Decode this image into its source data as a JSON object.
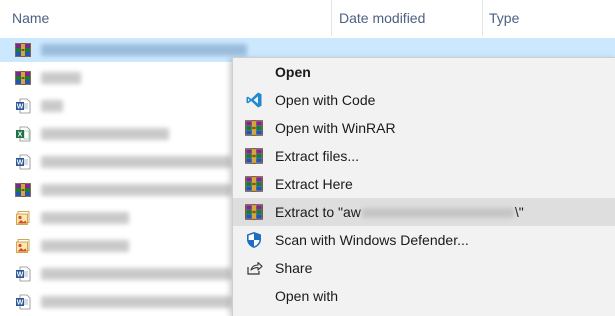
{
  "columns": {
    "name": "Name",
    "date_modified": "Date modified",
    "type": "Type"
  },
  "files": [
    {
      "icon": "winrar-archive-icon",
      "selected": true
    },
    {
      "icon": "winrar-archive-icon",
      "selected": false
    },
    {
      "icon": "word-document-icon",
      "selected": false
    },
    {
      "icon": "excel-spreadsheet-icon",
      "selected": false
    },
    {
      "icon": "word-document-icon",
      "selected": false
    },
    {
      "icon": "winrar-archive-icon",
      "selected": false
    },
    {
      "icon": "image-file-icon",
      "selected": false
    },
    {
      "icon": "image-file-icon",
      "selected": false
    },
    {
      "icon": "word-document-icon",
      "selected": false
    },
    {
      "icon": "word-document-icon",
      "selected": false
    }
  ],
  "context_menu": {
    "items": [
      {
        "label": "Open",
        "icon": "none",
        "bold": true
      },
      {
        "label": "Open with Code",
        "icon": "vscode-icon"
      },
      {
        "label": "Open with WinRAR",
        "icon": "winrar-icon"
      },
      {
        "label": "Extract files...",
        "icon": "winrar-icon"
      },
      {
        "label": "Extract Here",
        "icon": "winrar-icon"
      },
      {
        "label_prefix": "Extract to \"aw",
        "label_suffix": "\\\"",
        "icon": "winrar-icon",
        "hover": true
      },
      {
        "label": "Scan with Windows Defender...",
        "icon": "windows-defender-icon"
      },
      {
        "label": "Share",
        "icon": "share-icon"
      },
      {
        "label": "Open with",
        "icon": "none"
      }
    ]
  },
  "colors": {
    "selection": "#cce8ff",
    "menu_background": "#f2f2f2",
    "menu_hover": "#dedede",
    "header_text": "#4d6082"
  }
}
